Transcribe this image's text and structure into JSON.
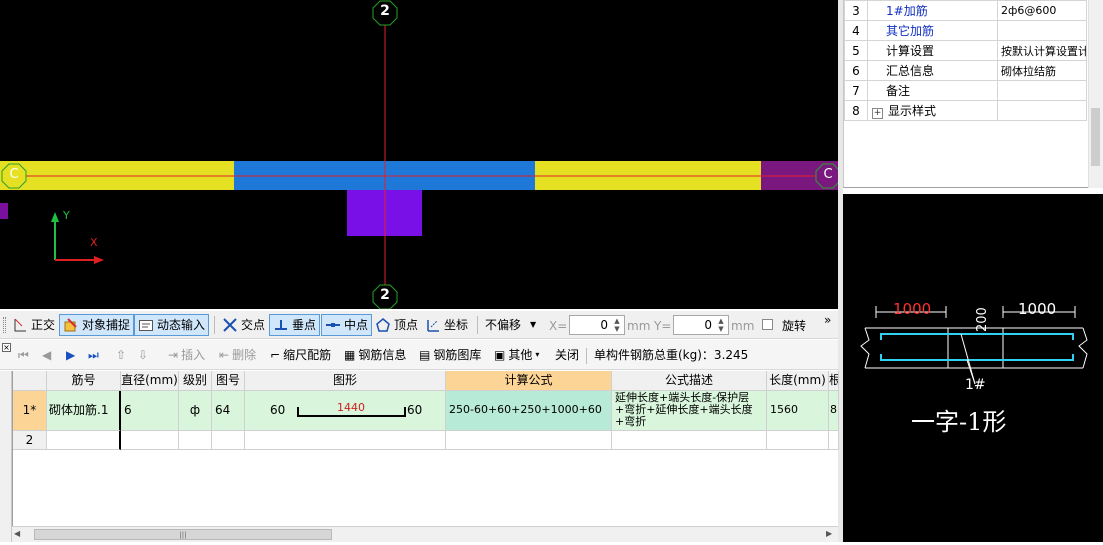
{
  "cad": {
    "axis_top_label": "2",
    "axis_bottom_label": "2",
    "axis_left_label": "C",
    "axis_right_label": "C",
    "ucs_y": "Y",
    "ucs_x": "X"
  },
  "properties": {
    "rows": [
      {
        "num": "3",
        "name": "1#加筋",
        "value": "2ф6@600",
        "name_blue": true
      },
      {
        "num": "4",
        "name": "其它加筋",
        "value": "",
        "name_blue": true
      },
      {
        "num": "5",
        "name": "计算设置",
        "value": "按默认计算设置计算",
        "name_blue": false
      },
      {
        "num": "6",
        "name": "汇总信息",
        "value": "砌体拉结筋",
        "name_blue": false
      },
      {
        "num": "7",
        "name": "备注",
        "value": "",
        "name_blue": false
      },
      {
        "num": "8",
        "name": "显示样式",
        "value": "",
        "name_blue": false,
        "expandable": true
      }
    ]
  },
  "preview": {
    "dim_left": "1000",
    "dim_right": "1000",
    "dim_vertical": "200",
    "rebar_tag": "1#",
    "caption": "一字-1形"
  },
  "snap_toolbar": {
    "orthogonal": "正交",
    "object_snap": "对象捕捉",
    "dynamic_input": "动态输入",
    "intersection": "交点",
    "perpendicular": "垂点",
    "midpoint": "中点",
    "vertex": "顶点",
    "coordinate": "坐标",
    "offset_mode": "不偏移",
    "x_label": "X=",
    "x_value": "0",
    "y_label": "Y=",
    "y_value": "0",
    "unit_x": "mm",
    "unit_y": "mm",
    "rotate": "旋转"
  },
  "rebar_toolbar": {
    "insert": "插入",
    "delete": "删除",
    "scale_rebar": "缩尺配筋",
    "rebar_info": "钢筋信息",
    "rebar_library": "钢筋图库",
    "other": "其他",
    "close": "关闭",
    "total_weight": "单构件钢筋总重(kg)：3.245"
  },
  "grid": {
    "headers": [
      "筋号",
      "直径(mm)",
      "级别",
      "图号",
      "图形",
      "计算公式",
      "公式描述",
      "长度(mm)",
      "根"
    ],
    "rows": [
      {
        "row_label": "1*",
        "name": "砌体加筋.1",
        "diameter": "6",
        "grade": "ф",
        "figure_no": "64",
        "shape_left": "60",
        "shape_mid": "1440",
        "shape_right": "60",
        "formula": "250-60+60+250+1000+60",
        "description": "延伸长度+端头长度-保护层+弯折+延伸长度+端头长度+弯折",
        "length": "1560",
        "count": "8"
      },
      {
        "row_label": "2",
        "name": "",
        "diameter": "",
        "grade": "",
        "figure_no": "",
        "formula": "",
        "description": "",
        "length": "",
        "count": ""
      }
    ]
  },
  "colors": {
    "cad_background": "#000000",
    "wall_yellow": "#e6e022",
    "wall_blue": "#1e78d8",
    "column_purple": "#7a10e8",
    "axis_red": "#e0202a",
    "axis_bubble_green": "#2aa02a",
    "selected_header": "#fbd496",
    "selected_row": "#d9f5dc"
  }
}
